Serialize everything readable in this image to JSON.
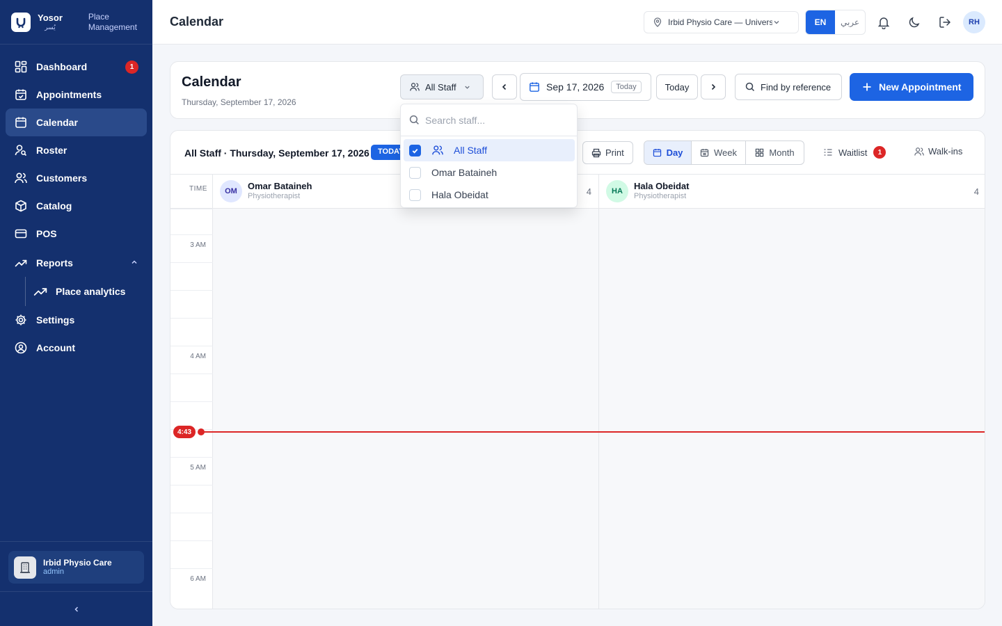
{
  "brand": {
    "name": "Yosor",
    "name_ar": "يُسر",
    "subtitle_line1": "Place",
    "subtitle_line2": "Management"
  },
  "sidebar": {
    "items": [
      {
        "label": "Dashboard",
        "icon": "dashboard-icon",
        "badge": "1"
      },
      {
        "label": "Appointments",
        "icon": "calendar-check-icon"
      },
      {
        "label": "Calendar",
        "icon": "calendar-icon",
        "active": true
      },
      {
        "label": "Roster",
        "icon": "user-search-icon"
      },
      {
        "label": "Customers",
        "icon": "users-icon"
      },
      {
        "label": "Catalog",
        "icon": "package-icon"
      },
      {
        "label": "POS",
        "icon": "credit-card-icon"
      },
      {
        "label": "Reports",
        "icon": "trending-icon",
        "expanded": true
      },
      {
        "label": "Settings",
        "icon": "gear-icon"
      },
      {
        "label": "Account",
        "icon": "user-circle-icon"
      }
    ],
    "sub_items": [
      {
        "label": "Place analytics",
        "icon": "trending-icon"
      }
    ],
    "footer": {
      "place_name": "Irbid Physio Care",
      "role": "admin"
    }
  },
  "topbar": {
    "title": "Calendar",
    "place_select": "Irbid Physio Care — University Branch",
    "lang_en": "EN",
    "lang_ar": "عربي",
    "avatar_initials": "RH"
  },
  "header": {
    "title": "Calendar",
    "subtitle": "Thursday, September 17, 2026",
    "staff_filter": "All Staff",
    "date": "Sep 17, 2026",
    "date_chip": "Today",
    "today_button": "Today",
    "find_button": "Find by reference",
    "new_button": "New Appointment"
  },
  "calendar": {
    "heading": "All Staff · Thursday, September 17, 2026",
    "today_badge": "TODAY",
    "print": "Print",
    "views": [
      "Day",
      "Week",
      "Month"
    ],
    "active_view": "Day",
    "waitlist": "Waitlist",
    "waitlist_count": "1",
    "walkins": "Walk-ins",
    "time_header": "TIME",
    "time_labels": [
      "3 AM",
      "4 AM",
      "5 AM",
      "6 AM"
    ],
    "now_label": "4:43",
    "staff": [
      {
        "initials": "OM",
        "name": "Omar Bataineh",
        "role": "Physiotherapist",
        "count": "4",
        "color": "#e0e7ff",
        "text_color": "#3730a3"
      },
      {
        "initials": "HA",
        "name": "Hala Obeidat",
        "role": "Physiotherapist",
        "count": "4",
        "color": "#d1fae5",
        "text_color": "#047857"
      }
    ]
  },
  "dropdown": {
    "search_placeholder": "Search staff...",
    "options": [
      {
        "label": "All Staff",
        "checked": true
      },
      {
        "label": "Omar Bataineh",
        "checked": false
      },
      {
        "label": "Hala Obeidat",
        "checked": false
      }
    ]
  },
  "colors": {
    "sidebar": "#14306e",
    "accent": "#1d64e3",
    "danger": "#dc2626"
  }
}
